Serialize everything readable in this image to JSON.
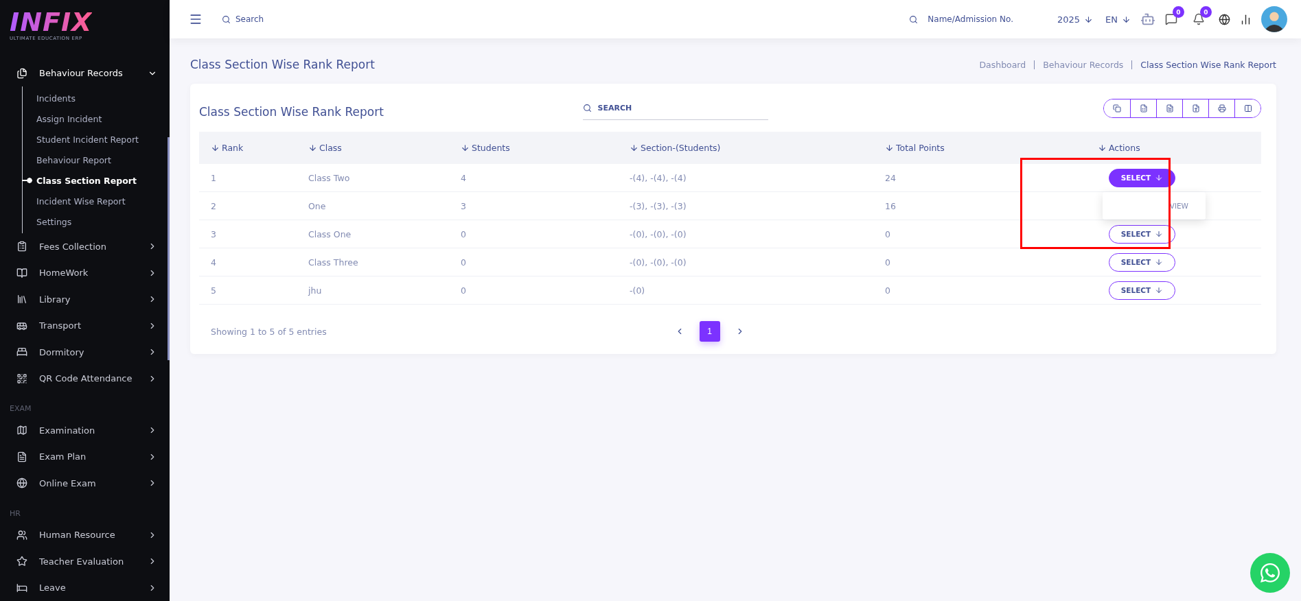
{
  "logo": {
    "name": "INFIX",
    "tagline": "ULTIMATE EDUCATION ERP"
  },
  "sidebar": {
    "sections": [
      {
        "items": [
          {
            "label": "Behaviour Records",
            "expanded": true,
            "children": [
              {
                "label": "Incidents",
                "selected": false
              },
              {
                "label": "Assign Incident",
                "selected": false
              },
              {
                "label": "Student Incident Report",
                "selected": false
              },
              {
                "label": "Behaviour Report",
                "selected": false
              },
              {
                "label": "Class Section Report",
                "selected": true
              },
              {
                "label": "Incident Wise Report",
                "selected": false
              },
              {
                "label": "Settings",
                "selected": false
              }
            ]
          },
          {
            "label": "Fees Collection",
            "expanded": false
          },
          {
            "label": "HomeWork",
            "expanded": false
          },
          {
            "label": "Library",
            "expanded": false
          },
          {
            "label": "Transport",
            "expanded": false
          },
          {
            "label": "Dormitory",
            "expanded": false
          },
          {
            "label": "QR Code Attendance",
            "expanded": false
          }
        ]
      },
      {
        "heading": "EXAM",
        "items": [
          {
            "label": "Examination",
            "expanded": false
          },
          {
            "label": "Exam Plan",
            "expanded": false
          },
          {
            "label": "Online Exam",
            "expanded": false
          }
        ]
      },
      {
        "heading": "HR",
        "items": [
          {
            "label": "Human Resource",
            "expanded": false
          },
          {
            "label": "Teacher Evaluation",
            "expanded": false
          },
          {
            "label": "Leave",
            "expanded": false
          }
        ]
      }
    ]
  },
  "topbar": {
    "search_placeholder": "Search",
    "student_search_placeholder": "Name/Admission No.",
    "year": "2025",
    "language": "EN",
    "messages_count": "0",
    "notifications_count": "0"
  },
  "page": {
    "title": "Class Section Wise Rank Report",
    "breadcrumbs": [
      "Dashboard",
      "Behaviour Records",
      "Class Section Wise Rank Report"
    ]
  },
  "card": {
    "title": "Class Section Wise Rank Report",
    "search_placeholder": "SEARCH",
    "columns": [
      "Rank",
      "Class",
      "Students",
      "Section-(Students)",
      "Total Points",
      "Actions"
    ],
    "rows": [
      {
        "cells": [
          "1",
          "Class Two",
          "4",
          "-(4), -(4), -(4)",
          "24"
        ],
        "action": "SELECT",
        "menu_open": true,
        "menu_items": [
          "VIEW"
        ]
      },
      {
        "cells": [
          "2",
          "One",
          "3",
          "-(3), -(3), -(3)",
          "16"
        ],
        "menu_open": false
      },
      {
        "cells": [
          "3",
          "Class One",
          "0",
          "-(0), -(0), -(0)",
          "0"
        ],
        "action": "SELECT",
        "menu_open": false
      },
      {
        "cells": [
          "4",
          "Class Three",
          "0",
          "-(0), -(0), -(0)",
          "0"
        ],
        "action": "SELECT",
        "menu_open": false
      },
      {
        "cells": [
          "5",
          "jhu",
          "0",
          "-(0)",
          "0"
        ],
        "action": "SELECT",
        "menu_open": false
      }
    ],
    "footer": "Showing 1 to 5 of 5 entries",
    "pages": [
      {
        "label": "1",
        "selected": true
      }
    ]
  }
}
